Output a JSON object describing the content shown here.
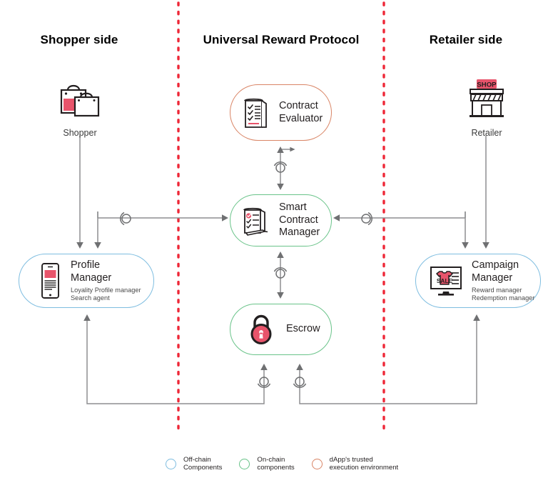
{
  "diagram": {
    "title_columns": {
      "shopper": "Shopper side",
      "protocol": "Universal Reward Protocol",
      "retailer": "Retailer side"
    },
    "actors": [
      {
        "id": "shopper",
        "label": "Shopper",
        "icon": "shopping-bags-icon"
      },
      {
        "id": "retailer",
        "label": "Retailer",
        "icon": "storefront-shop-icon",
        "sign_text": "SHOP"
      }
    ],
    "nodes": [
      {
        "id": "contract-evaluator",
        "title": "Contract\nEvaluator",
        "subtitle": "",
        "icon": "checklist-document-icon",
        "border_color": "#d98566",
        "category": "dapp-trusted-execution-environment"
      },
      {
        "id": "smart-contract-manager",
        "title": "Smart\nContract\nManager",
        "subtitle": "",
        "icon": "contract-scroll-pen-icon",
        "border_color": "#69c389",
        "category": "on-chain"
      },
      {
        "id": "escrow",
        "title": "Escrow",
        "subtitle": "",
        "icon": "padlock-icon",
        "border_color": "#69c389",
        "category": "on-chain"
      },
      {
        "id": "profile-manager",
        "title": "Profile\nManager",
        "subtitle": "Loyality Profile manager\nSearch agent",
        "icon": "smartphone-icon",
        "border_color": "#7ebde0",
        "category": "off-chain"
      },
      {
        "id": "campaign-manager",
        "title": "Campaign\nManager",
        "subtitle": "Reward manager\nRedemption manager",
        "icon": "monitor-sale-shirt-icon",
        "border_color": "#7ebde0",
        "category": "off-chain"
      }
    ],
    "dividers": {
      "color": "#ee2737",
      "style": "dotted",
      "positions_x": [
        250,
        538
      ]
    },
    "legend": [
      {
        "id": "off-chain",
        "label": "Off-chain\nComponents",
        "color": "#7ebde0"
      },
      {
        "id": "on-chain",
        "label": "On-chain\ncomponents",
        "color": "#69c389"
      },
      {
        "id": "dapp-tee",
        "label": "dApp's trusted\nexecution environment",
        "color": "#d98566"
      }
    ]
  }
}
